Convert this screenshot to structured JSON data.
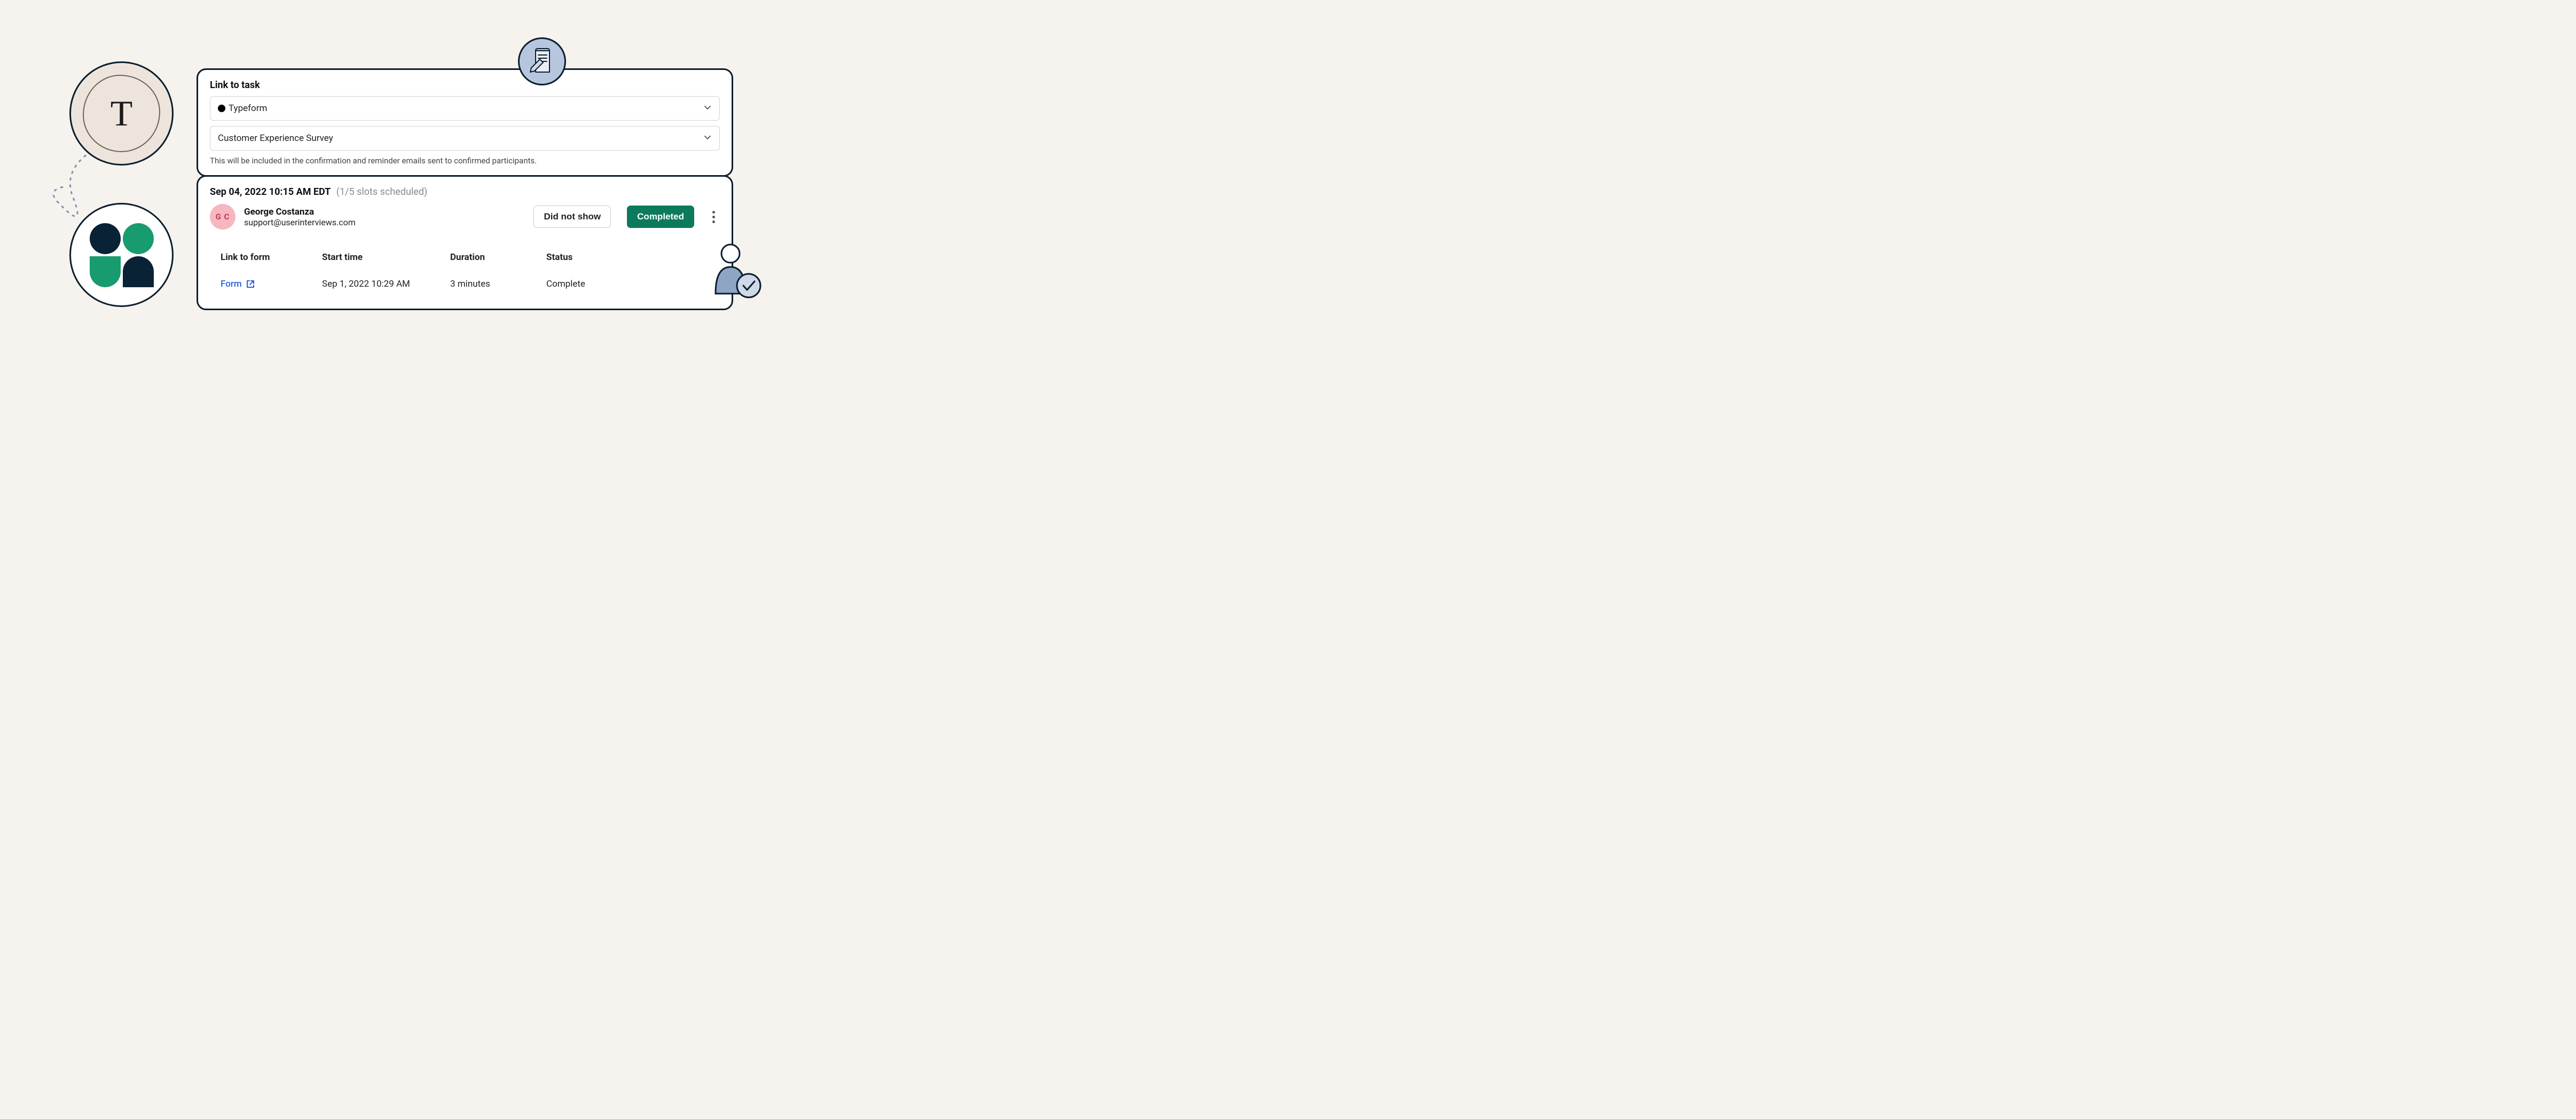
{
  "linkTask": {
    "heading": "Link to task",
    "toolSelect": "Typeform",
    "surveySelect": "Customer Experience Survey",
    "helper": "This will be included in the confirmation and reminder emails sent to confirmed participants."
  },
  "session": {
    "datetime": "Sep 04, 2022 10:15 AM EDT",
    "slots": "(1/5 slots scheduled)",
    "participant": {
      "initials": "G C",
      "name": "George Costanza",
      "email": "support@userinterviews.com"
    },
    "buttons": {
      "didNotShow": "Did not show",
      "completed": "Completed"
    },
    "table": {
      "headers": {
        "link": "Link to form",
        "start": "Start time",
        "duration": "Duration",
        "status": "Status"
      },
      "row": {
        "link": "Form",
        "start": "Sep 1, 2022 10:29 AM",
        "duration": "3 minutes",
        "status": "Complete"
      }
    }
  },
  "decor": {
    "tLetter": "T"
  }
}
